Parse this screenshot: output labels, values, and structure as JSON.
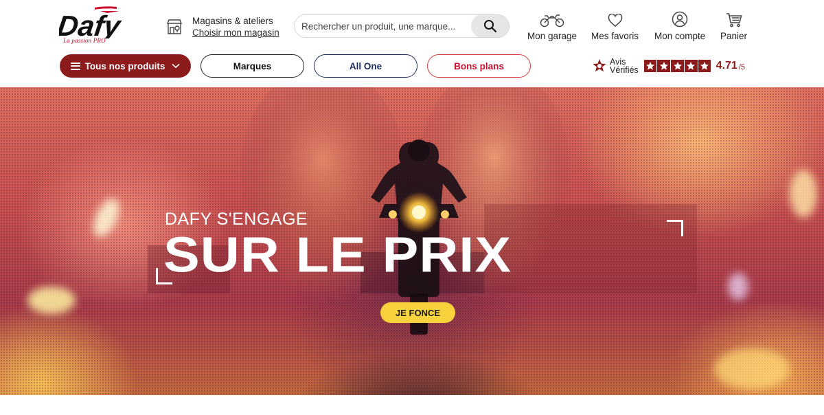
{
  "header": {
    "logo": {
      "brand": "Dafy",
      "tagline": "La passion PRO"
    },
    "store": {
      "title": "Magasins & ateliers",
      "link": "Choisir mon magasin",
      "icon": "store-icon"
    },
    "search": {
      "placeholder": "Rechercher un produit, une marque...",
      "value": "",
      "icon": "search-icon"
    },
    "account_nav": [
      {
        "label": "Mon garage",
        "icon": "motorcycle-icon"
      },
      {
        "label": "Mes favoris",
        "icon": "heart-icon"
      },
      {
        "label": "Mon compte",
        "icon": "user-icon"
      },
      {
        "label": "Panier",
        "icon": "cart-icon"
      }
    ]
  },
  "nav": {
    "products_label": "Tous nos produits",
    "brands_label": "Marques",
    "allone_label": "All One",
    "deals_label": "Bons plans"
  },
  "reviews": {
    "brand_line1": "Avis",
    "brand_line2": "Vérifiés",
    "stars": 5,
    "rating": "4.71",
    "rating_max": "/5"
  },
  "hero": {
    "kicker": "DAFY S'ENGAGE",
    "title": "SUR LE PRIX",
    "cta_label": "JE FONCE"
  },
  "colors": {
    "brand_red": "#8c1c1c",
    "accent_red": "#c8102e",
    "navy": "#1a2a5a",
    "cta_yellow": "#f7d23c"
  }
}
